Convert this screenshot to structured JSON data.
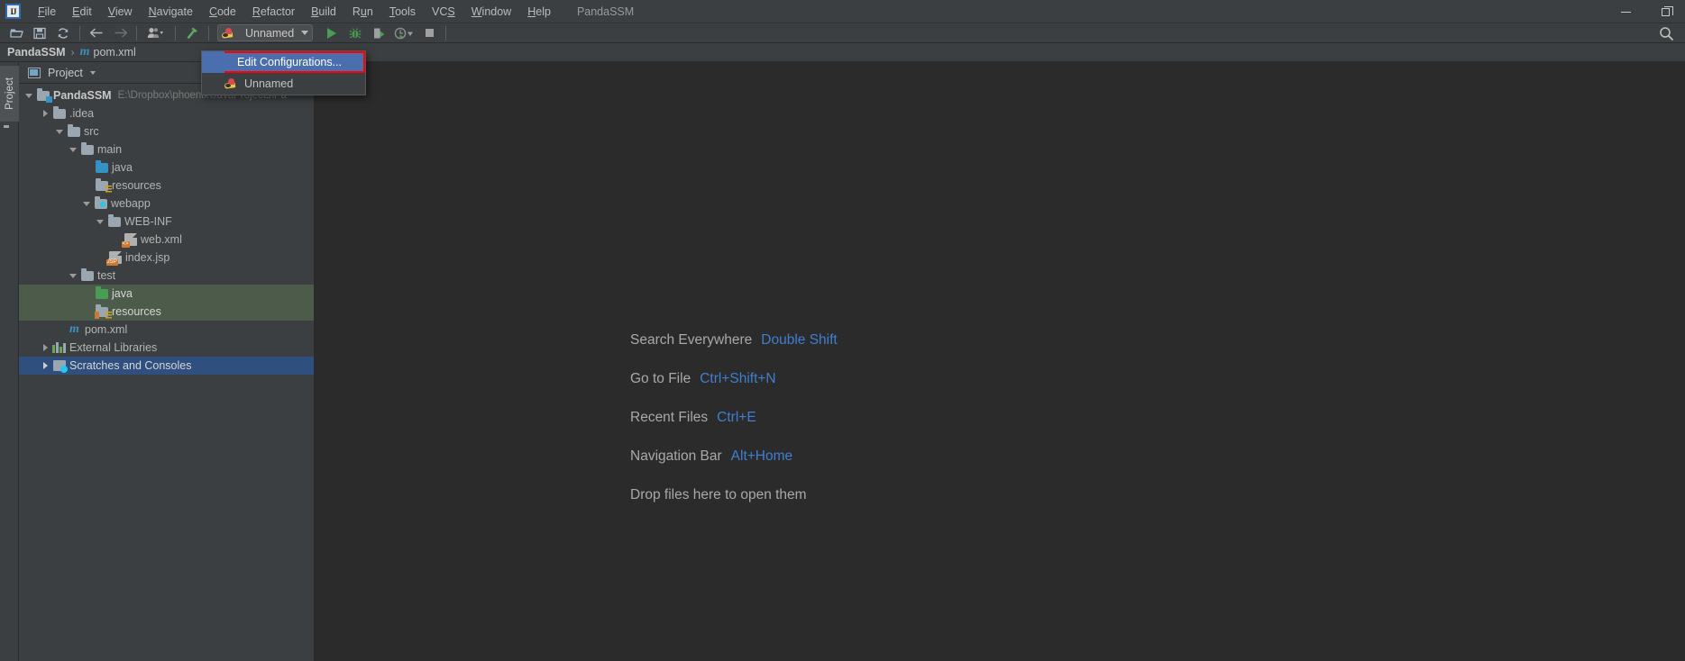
{
  "window": {
    "title": "PandaSSM",
    "controls": {
      "minimize": "minimize-icon",
      "maximize": "maximize-icon"
    }
  },
  "menubar": {
    "logo": "intellij-idea-logo",
    "items": [
      {
        "label": "File",
        "mnemonic": "F"
      },
      {
        "label": "Edit",
        "mnemonic": "E"
      },
      {
        "label": "View",
        "mnemonic": "V"
      },
      {
        "label": "Navigate",
        "mnemonic": "N"
      },
      {
        "label": "Code",
        "mnemonic": "C"
      },
      {
        "label": "Refactor",
        "mnemonic": "R"
      },
      {
        "label": "Build",
        "mnemonic": "B"
      },
      {
        "label": "Run",
        "mnemonic": "u"
      },
      {
        "label": "Tools",
        "mnemonic": "T"
      },
      {
        "label": "VCS",
        "mnemonic": "S"
      },
      {
        "label": "Window",
        "mnemonic": "W"
      },
      {
        "label": "Help",
        "mnemonic": "H"
      }
    ]
  },
  "toolbar": {
    "buttons": [
      {
        "name": "open-project-icon",
        "tooltip": "Open"
      },
      {
        "name": "save-all-icon",
        "tooltip": "Save All"
      },
      {
        "name": "sync-refresh-icon",
        "tooltip": "Synchronize"
      },
      {
        "name": "back-arrow-icon",
        "tooltip": "Back"
      },
      {
        "name": "forward-arrow-icon",
        "tooltip": "Forward"
      },
      {
        "name": "profile-icon",
        "tooltip": "Settings"
      },
      {
        "name": "build-hammer-icon",
        "tooltip": "Build"
      }
    ],
    "run_config": {
      "label": "Unnamed",
      "icon": "run-config-bug-icon"
    },
    "run_button": "run-icon",
    "debug_button": "debug-icon",
    "run_coverage_button": "run-with-coverage-icon",
    "profiler_button": "profiler-icon",
    "stop_button": "stop-icon",
    "search_button": "search-icon"
  },
  "dropdown": {
    "items": [
      {
        "label": "Edit Configurations...",
        "highlighted": true,
        "icon": null
      },
      {
        "label": "Unnamed",
        "highlighted": false,
        "icon": "run-config-bug-icon"
      }
    ]
  },
  "breadcrumb": {
    "project": "PandaSSM",
    "separator": "›",
    "file_icon": "m",
    "file": "pom.xml"
  },
  "left_strip": {
    "tab_label": "Project",
    "folder_icon": "folder-icon"
  },
  "project_panel": {
    "title": "Project",
    "caret": "chevron-down-icon",
    "tools": [
      "collapse-all-icon",
      "settings-gear-icon",
      "hide-icon"
    ],
    "tree": [
      {
        "indent": 0,
        "arrow": "down",
        "icon": "module-folder",
        "label": "PandaSSM",
        "bold": true,
        "path": "E:\\Dropbox\\phoenix\\JavaProjects\\Pa",
        "selected": "none"
      },
      {
        "indent": 1,
        "arrow": "right",
        "icon": "folder",
        "label": ".idea",
        "bold": false,
        "path": "",
        "selected": "none"
      },
      {
        "indent": 1,
        "arrow": "down",
        "icon": "folder",
        "label": "src",
        "bold": false,
        "path": "",
        "selected": "none"
      },
      {
        "indent": 2,
        "arrow": "down",
        "icon": "folder",
        "label": "main",
        "bold": false,
        "path": "",
        "selected": "none"
      },
      {
        "indent": 3,
        "arrow": "none",
        "icon": "source-folder",
        "label": "java",
        "bold": false,
        "path": "",
        "selected": "none"
      },
      {
        "indent": 3,
        "arrow": "none",
        "icon": "resource-folder",
        "label": "resources",
        "bold": false,
        "path": "",
        "selected": "none"
      },
      {
        "indent": 2,
        "arrow": "down",
        "icon": "webapp-folder",
        "label": "webapp",
        "bold": false,
        "path": "",
        "selected": "none"
      },
      {
        "indent": 3,
        "arrow": "down",
        "icon": "folder",
        "label": "WEB-INF",
        "bold": false,
        "path": "",
        "selected": "none"
      },
      {
        "indent": 4,
        "arrow": "none",
        "icon": "xml-file",
        "label": "web.xml",
        "bold": false,
        "path": "",
        "selected": "none"
      },
      {
        "indent": 3,
        "arrow": "none",
        "icon": "jsp-file",
        "label": "index.jsp",
        "bold": false,
        "path": "",
        "selected": "none"
      },
      {
        "indent": 2,
        "arrow": "down",
        "icon": "folder",
        "label": "test",
        "bold": false,
        "path": "",
        "selected": "none"
      },
      {
        "indent": 3,
        "arrow": "none",
        "icon": "test-source-folder",
        "label": "java",
        "bold": false,
        "path": "",
        "selected": "green"
      },
      {
        "indent": 3,
        "arrow": "none",
        "icon": "test-resource-folder",
        "label": "resources",
        "bold": false,
        "path": "",
        "selected": "green"
      },
      {
        "indent": 2,
        "arrow": "none",
        "icon": "maven-file",
        "label": "pom.xml",
        "bold": false,
        "path": "",
        "selected": "none"
      },
      {
        "indent": 0,
        "arrow": "right",
        "icon": "libraries",
        "label": "External Libraries",
        "bold": false,
        "path": "",
        "selected": "none"
      },
      {
        "indent": 0,
        "arrow": "right",
        "icon": "scratches",
        "label": "Scratches and Consoles",
        "bold": false,
        "path": "",
        "selected": "blue"
      }
    ]
  },
  "editor": {
    "welcome": [
      {
        "text": "Search Everywhere",
        "key": "Double Shift"
      },
      {
        "text": "Go to File",
        "key": "Ctrl+Shift+N"
      },
      {
        "text": "Recent Files",
        "key": "Ctrl+E"
      },
      {
        "text": "Navigation Bar",
        "key": "Alt+Home"
      },
      {
        "text": "Drop files here to open them",
        "key": ""
      }
    ]
  },
  "colors": {
    "background": "#3c3f41",
    "editor_background": "#2b2b2b",
    "text": "#b4b4b4",
    "accent_blue": "#3f7fd0",
    "selection_blue": "#4b6eaf",
    "selection_green": "#4d5b4b",
    "selection_navy": "#2f4f7f",
    "highlight_border_red": "#ff0000",
    "run_green": "#499c54",
    "maven_blue": "#3d8fc0"
  }
}
